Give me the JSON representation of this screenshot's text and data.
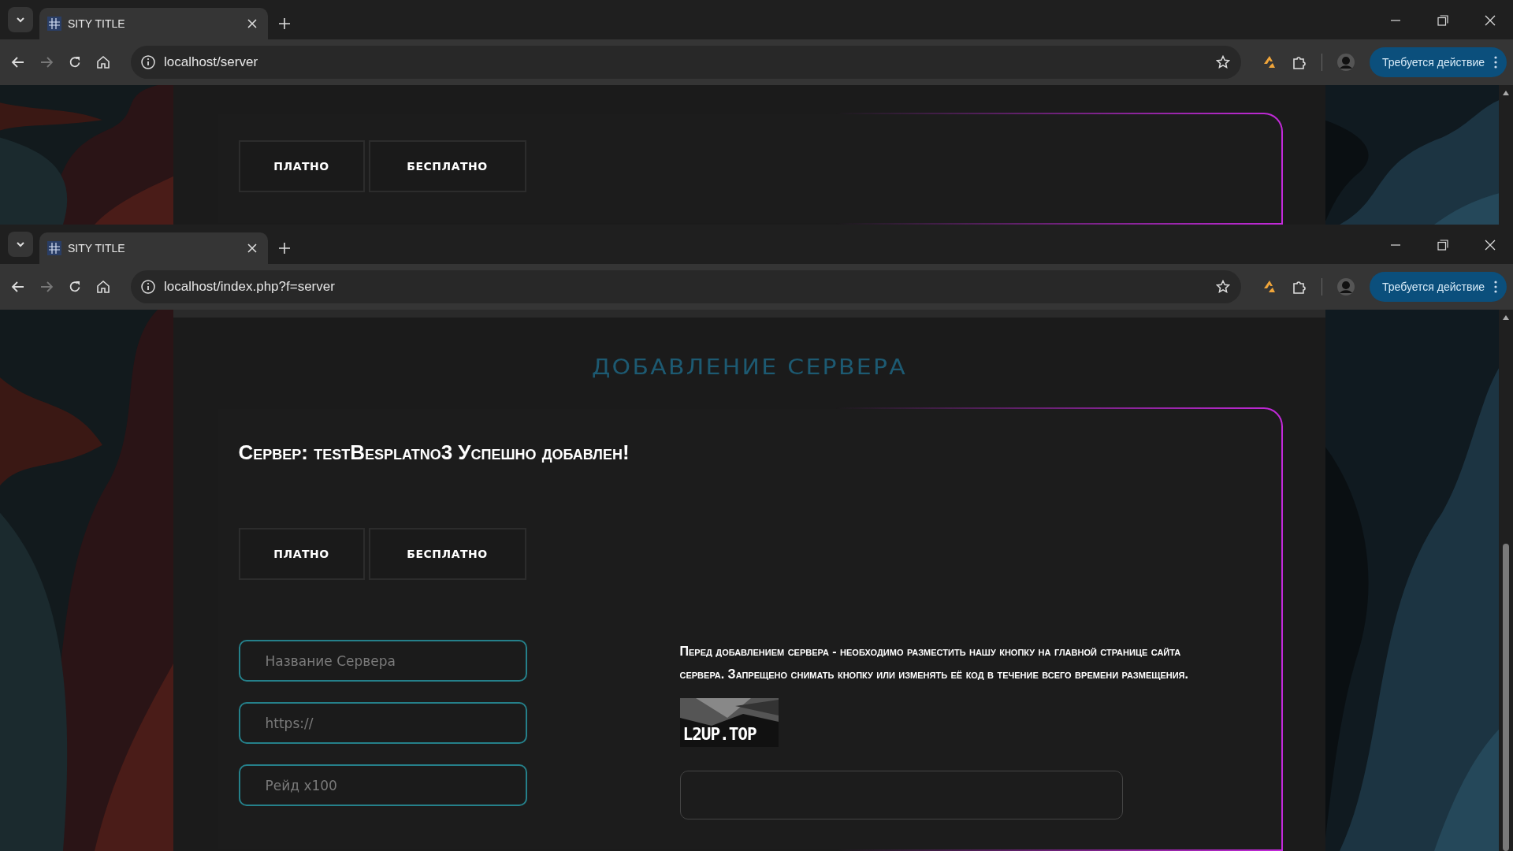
{
  "windows": [
    {
      "tab": {
        "title": "SITY TITLE",
        "selected": true
      },
      "url": "localhost/server",
      "action_button": "Требуется действие",
      "page": {
        "kind": "partial",
        "type_buttons": [
          {
            "label": "ПЛАТНО"
          },
          {
            "label": "БЕСПЛАТНО"
          }
        ]
      }
    },
    {
      "tab": {
        "title": "SITY TITLE",
        "selected": true
      },
      "url": "localhost/index.php?f=server",
      "action_button": "Требуется действие",
      "page": {
        "kind": "full",
        "heading": "ДОБАВЛЕНИЕ СЕРВЕРА",
        "message": "Сервер: testBesplatno3 Успешно добавлен!",
        "type_buttons": [
          {
            "label": "ПЛАТНО"
          },
          {
            "label": "БЕСПЛАТНО"
          }
        ],
        "fields": [
          {
            "placeholder": "Название Сервера"
          },
          {
            "placeholder": "https://"
          },
          {
            "placeholder": "Рейд x100"
          }
        ],
        "notice": "Перед добавлением сервера - необходимо разместить нашу кнопку на главной странице сайта сервера. Запрещено снимать кнопку или изменять её код в течение всего времени размещения.",
        "banner": "L2UP.TOP"
      }
    }
  ]
}
